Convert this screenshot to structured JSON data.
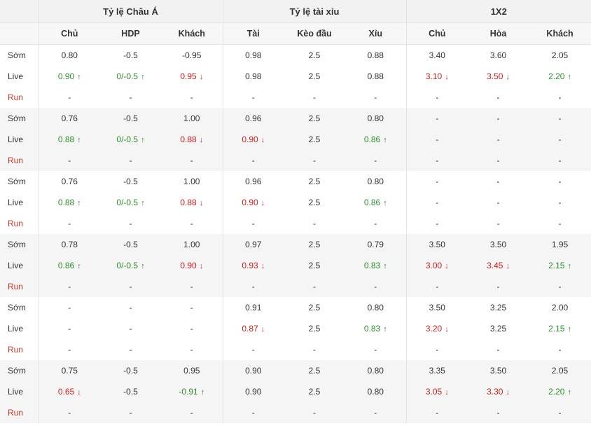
{
  "headers": {
    "groups": [
      "Tỷ lệ Châu Á",
      "Tỷ lệ tài xỉu",
      "1X2"
    ],
    "columns": [
      "Chủ",
      "HDP",
      "Khách",
      "Tài",
      "Kèo đầu",
      "Xỉu",
      "Chủ",
      "Hòa",
      "Khách"
    ]
  },
  "colors": {
    "up": "#2e8b2e",
    "down": "#cc2222",
    "run_label": "#c0392b"
  },
  "icons": {
    "up": "arrow-up-icon",
    "down": "arrow-down-icon"
  },
  "blocks": [
    {
      "rows": [
        {
          "label": "Sớm",
          "cells": [
            {
              "v": "0.80"
            },
            {
              "v": "-0.5"
            },
            {
              "v": "-0.95"
            },
            {
              "v": "0.98"
            },
            {
              "v": "2.5"
            },
            {
              "v": "0.88"
            },
            {
              "v": "3.40"
            },
            {
              "v": "3.60"
            },
            {
              "v": "2.05"
            }
          ]
        },
        {
          "label": "Live",
          "cells": [
            {
              "v": "0.90",
              "t": "up"
            },
            {
              "v": "0/-0.5",
              "t": "up"
            },
            {
              "v": "0.95",
              "t": "down"
            },
            {
              "v": "0.98"
            },
            {
              "v": "2.5"
            },
            {
              "v": "0.88"
            },
            {
              "v": "3.10",
              "t": "down"
            },
            {
              "v": "3.50",
              "t": "down"
            },
            {
              "v": "2.20",
              "t": "up"
            }
          ]
        },
        {
          "label": "Run",
          "cells": [
            {
              "v": "-"
            },
            {
              "v": "-"
            },
            {
              "v": "-"
            },
            {
              "v": "-"
            },
            {
              "v": "-"
            },
            {
              "v": "-"
            },
            {
              "v": "-"
            },
            {
              "v": "-"
            },
            {
              "v": "-"
            }
          ]
        }
      ]
    },
    {
      "rows": [
        {
          "label": "Sớm",
          "cells": [
            {
              "v": "0.76"
            },
            {
              "v": "-0.5"
            },
            {
              "v": "1.00"
            },
            {
              "v": "0.96"
            },
            {
              "v": "2.5"
            },
            {
              "v": "0.80"
            },
            {
              "v": "-"
            },
            {
              "v": "-"
            },
            {
              "v": "-"
            }
          ]
        },
        {
          "label": "Live",
          "cells": [
            {
              "v": "0.88",
              "t": "up"
            },
            {
              "v": "0/-0.5",
              "t": "up"
            },
            {
              "v": "0.88",
              "t": "down"
            },
            {
              "v": "0.90",
              "t": "down"
            },
            {
              "v": "2.5"
            },
            {
              "v": "0.86",
              "t": "up"
            },
            {
              "v": "-"
            },
            {
              "v": "-"
            },
            {
              "v": "-"
            }
          ]
        },
        {
          "label": "Run",
          "cells": [
            {
              "v": "-"
            },
            {
              "v": "-"
            },
            {
              "v": "-"
            },
            {
              "v": "-"
            },
            {
              "v": "-"
            },
            {
              "v": "-"
            },
            {
              "v": "-"
            },
            {
              "v": "-"
            },
            {
              "v": "-"
            }
          ]
        }
      ]
    },
    {
      "rows": [
        {
          "label": "Sớm",
          "cells": [
            {
              "v": "0.76"
            },
            {
              "v": "-0.5"
            },
            {
              "v": "1.00"
            },
            {
              "v": "0.96"
            },
            {
              "v": "2.5"
            },
            {
              "v": "0.80"
            },
            {
              "v": "-"
            },
            {
              "v": "-"
            },
            {
              "v": "-"
            }
          ]
        },
        {
          "label": "Live",
          "cells": [
            {
              "v": "0.88",
              "t": "up"
            },
            {
              "v": "0/-0.5",
              "t": "up"
            },
            {
              "v": "0.88",
              "t": "down"
            },
            {
              "v": "0.90",
              "t": "down"
            },
            {
              "v": "2.5"
            },
            {
              "v": "0.86",
              "t": "up"
            },
            {
              "v": "-"
            },
            {
              "v": "-"
            },
            {
              "v": "-"
            }
          ]
        },
        {
          "label": "Run",
          "cells": [
            {
              "v": "-"
            },
            {
              "v": "-"
            },
            {
              "v": "-"
            },
            {
              "v": "-"
            },
            {
              "v": "-"
            },
            {
              "v": "-"
            },
            {
              "v": "-"
            },
            {
              "v": "-"
            },
            {
              "v": "-"
            }
          ]
        }
      ]
    },
    {
      "rows": [
        {
          "label": "Sớm",
          "cells": [
            {
              "v": "0.78"
            },
            {
              "v": "-0.5"
            },
            {
              "v": "1.00"
            },
            {
              "v": "0.97"
            },
            {
              "v": "2.5"
            },
            {
              "v": "0.79"
            },
            {
              "v": "3.50"
            },
            {
              "v": "3.50"
            },
            {
              "v": "1.95"
            }
          ]
        },
        {
          "label": "Live",
          "cells": [
            {
              "v": "0.86",
              "t": "up"
            },
            {
              "v": "0/-0.5",
              "t": "up"
            },
            {
              "v": "0.90",
              "t": "down"
            },
            {
              "v": "0.93",
              "t": "down"
            },
            {
              "v": "2.5"
            },
            {
              "v": "0.83",
              "t": "up"
            },
            {
              "v": "3.00",
              "t": "down"
            },
            {
              "v": "3.45",
              "t": "down"
            },
            {
              "v": "2.15",
              "t": "up"
            }
          ]
        },
        {
          "label": "Run",
          "cells": [
            {
              "v": "-"
            },
            {
              "v": "-"
            },
            {
              "v": "-"
            },
            {
              "v": "-"
            },
            {
              "v": "-"
            },
            {
              "v": "-"
            },
            {
              "v": "-"
            },
            {
              "v": "-"
            },
            {
              "v": "-"
            }
          ]
        }
      ]
    },
    {
      "rows": [
        {
          "label": "Sớm",
          "cells": [
            {
              "v": "-"
            },
            {
              "v": "-"
            },
            {
              "v": "-"
            },
            {
              "v": "0.91"
            },
            {
              "v": "2.5"
            },
            {
              "v": "0.80"
            },
            {
              "v": "3.50"
            },
            {
              "v": "3.25"
            },
            {
              "v": "2.00"
            }
          ]
        },
        {
          "label": "Live",
          "cells": [
            {
              "v": "-"
            },
            {
              "v": "-"
            },
            {
              "v": "-"
            },
            {
              "v": "0.87",
              "t": "down"
            },
            {
              "v": "2.5"
            },
            {
              "v": "0.83",
              "t": "up"
            },
            {
              "v": "3.20",
              "t": "down"
            },
            {
              "v": "3.25"
            },
            {
              "v": "2.15",
              "t": "up"
            }
          ]
        },
        {
          "label": "Run",
          "cells": [
            {
              "v": "-"
            },
            {
              "v": "-"
            },
            {
              "v": "-"
            },
            {
              "v": "-"
            },
            {
              "v": "-"
            },
            {
              "v": "-"
            },
            {
              "v": "-"
            },
            {
              "v": "-"
            },
            {
              "v": "-"
            }
          ]
        }
      ]
    },
    {
      "rows": [
        {
          "label": "Sớm",
          "cells": [
            {
              "v": "0.75"
            },
            {
              "v": "-0.5"
            },
            {
              "v": "0.95"
            },
            {
              "v": "0.90"
            },
            {
              "v": "2.5"
            },
            {
              "v": "0.80"
            },
            {
              "v": "3.35"
            },
            {
              "v": "3.50"
            },
            {
              "v": "2.05"
            }
          ]
        },
        {
          "label": "Live",
          "cells": [
            {
              "v": "0.65",
              "t": "down"
            },
            {
              "v": "-0.5"
            },
            {
              "v": "-0.91",
              "t": "up"
            },
            {
              "v": "0.90"
            },
            {
              "v": "2.5"
            },
            {
              "v": "0.80"
            },
            {
              "v": "3.05",
              "t": "down"
            },
            {
              "v": "3.30",
              "t": "down"
            },
            {
              "v": "2.20",
              "t": "up"
            }
          ]
        },
        {
          "label": "Run",
          "cells": [
            {
              "v": "-"
            },
            {
              "v": "-"
            },
            {
              "v": "-"
            },
            {
              "v": "-"
            },
            {
              "v": "-"
            },
            {
              "v": "-"
            },
            {
              "v": "-"
            },
            {
              "v": "-"
            },
            {
              "v": "-"
            }
          ]
        }
      ]
    }
  ]
}
